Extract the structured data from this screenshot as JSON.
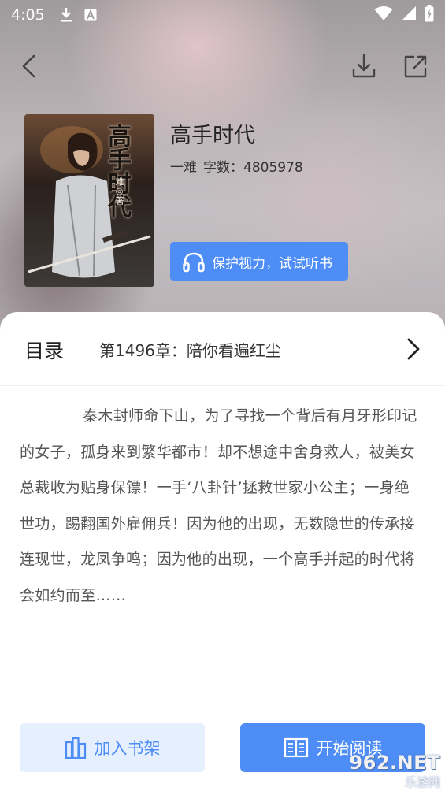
{
  "status_bar": {
    "time": "4:05",
    "icons": [
      "download-icon",
      "a-icon",
      "wifi-icon",
      "signal-icon",
      "battery-icon"
    ]
  },
  "nav": {
    "back_icon": "back-icon",
    "download_icon": "download-icon",
    "share_icon": "share-icon"
  },
  "book": {
    "title": "高手时代",
    "author": "一难",
    "word_count": "字数：4805978",
    "listen_button": "保护视力，试试听书",
    "cover_title": "高手时代",
    "cover_author": "难◎著"
  },
  "toc": {
    "label": "目录",
    "latest_chapter": "第1496章：陪你看遍红尘"
  },
  "synopsis": "秦木封师命下山，为了寻找一个背后有月牙形印记的女子，孤身来到繁华都市！却不想途中舍身救人，被美女总裁收为贴身保镖！一手‘八卦针’拯救世家小公主；一身绝世功，踢翻国外雇佣兵！因为他的出现，无数隐世的传承接连现世，龙凤争鸣；因为他的出现，一个高手并起的时代将会如约而至……",
  "buttons": {
    "add_shelf": "加入书架",
    "start_read": "开始阅读"
  },
  "watermark": {
    "main": "962.NET",
    "sub": "乐游网"
  },
  "colors": {
    "accent": "#4d8df5",
    "accent_light": "#e6effd"
  }
}
